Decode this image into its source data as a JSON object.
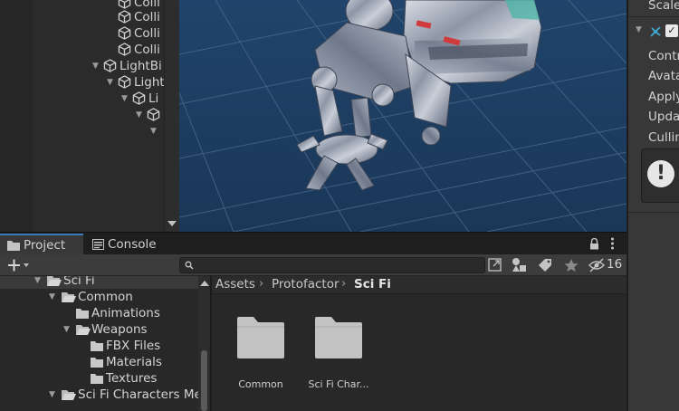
{
  "hierarchy": {
    "items": [
      {
        "label": "Colli",
        "expanded": null
      },
      {
        "label": "Colli",
        "expanded": null
      },
      {
        "label": "Colli",
        "expanded": null
      },
      {
        "label": "Colli",
        "expanded": null
      },
      {
        "label": "LightBi",
        "expanded": true
      },
      {
        "label": "Light",
        "expanded": true
      },
      {
        "label": "Li",
        "expanded": null
      },
      {
        "label": "",
        "expanded": true
      },
      {
        "label": "",
        "expanded": true
      }
    ]
  },
  "inspector": {
    "labels": [
      "Scale",
      "Contr",
      "Avata",
      "Apply",
      "Upda",
      "Cullin"
    ],
    "component_enabled": true
  },
  "project_panel": {
    "tabs": [
      {
        "label": "Project",
        "icon": "folder-icon",
        "active": true
      },
      {
        "label": "Console",
        "icon": "console-icon",
        "active": false
      }
    ],
    "search": {
      "value": "",
      "placeholder": ""
    },
    "hidden_packages_count": "16",
    "folder_tree": [
      {
        "label": "Sci Fi",
        "expanded": true,
        "selected": true
      },
      {
        "label": "Common",
        "expanded": true,
        "selected": false
      },
      {
        "label": "Animations",
        "expanded": null,
        "selected": false
      },
      {
        "label": "Weapons",
        "expanded": true,
        "selected": false
      },
      {
        "label": "FBX Files",
        "expanded": null,
        "selected": false
      },
      {
        "label": "Materials",
        "expanded": null,
        "selected": false
      },
      {
        "label": "Textures",
        "expanded": null,
        "selected": false
      },
      {
        "label": "Sci Fi Characters Me",
        "expanded": true,
        "selected": false
      }
    ],
    "breadcrumb": [
      "Assets",
      "Protofactor",
      "Sci Fi"
    ],
    "assets": [
      {
        "label": "Common",
        "type": "folder"
      },
      {
        "label": "Sci Fi Char...",
        "type": "folder"
      }
    ]
  },
  "colors": {
    "scene_background": "#1c3a5c",
    "panel_dark": "#282828",
    "accent": "#3a79bb"
  }
}
